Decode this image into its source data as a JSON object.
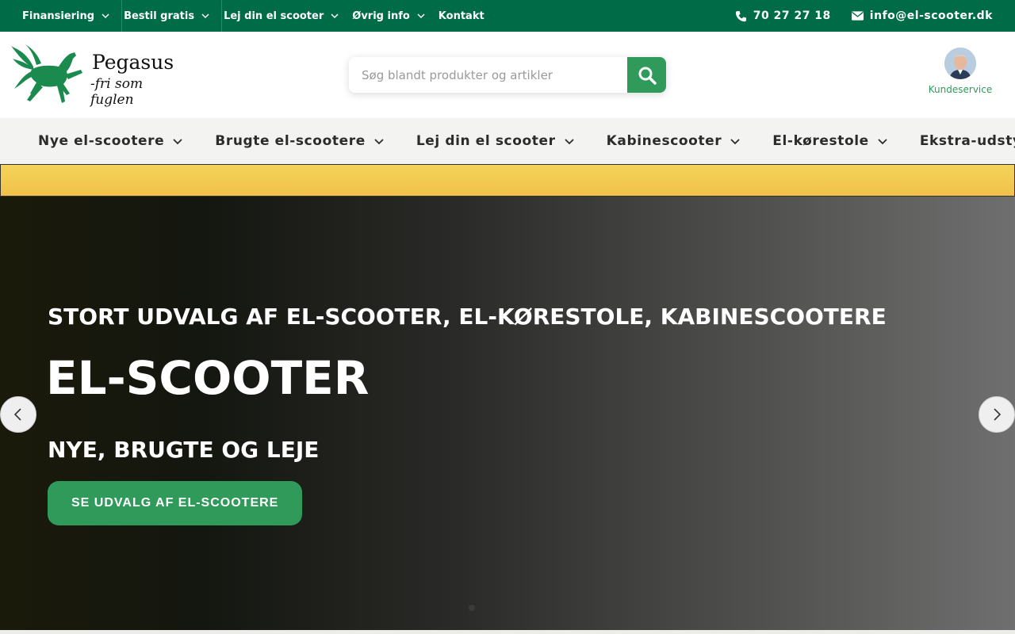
{
  "topbar": {
    "nav": [
      {
        "label": "Finansiering",
        "dropdown": true
      },
      {
        "label": "Bestil gratis",
        "dropdown": true
      },
      {
        "label": "Lej din el scooter",
        "dropdown": true
      },
      {
        "label": "Øvrig info",
        "dropdown": true
      },
      {
        "label": "Kontakt",
        "dropdown": false
      }
    ],
    "phone": "70 27 27 18",
    "email": "info@el-scooter.dk",
    "phone_icon": "phone-icon",
    "email_icon": "envelope-icon"
  },
  "header": {
    "logo_name": "Pegasus",
    "logo_slogan": "-fri som fuglen",
    "search_placeholder": "Søg blandt produkter og artikler",
    "search_icon": "search-icon",
    "customer_service_label": "Kundeservice"
  },
  "mainnav": {
    "items": [
      {
        "label": "Nye el-scootere"
      },
      {
        "label": "Brugte el-scootere"
      },
      {
        "label": "Lej din el scooter"
      },
      {
        "label": "Kabinescooter"
      },
      {
        "label": "El-kørestole"
      },
      {
        "label": "Ekstra-udstyr"
      }
    ]
  },
  "hero": {
    "subtitle": "STORT UDVALG AF EL-SCOOTER, EL-KØRESTOLE, KABINESCOOTERE",
    "title": "EL-SCOOTER",
    "tagline": "NYE, BRUGTE OG LEJE",
    "cta_label": "SE UDVALG AF EL-SCOOTERE"
  },
  "colors": {
    "brand_green": "#006b47",
    "accent_green": "#2f9a5a",
    "banner_yellow": "#f4d35a"
  }
}
